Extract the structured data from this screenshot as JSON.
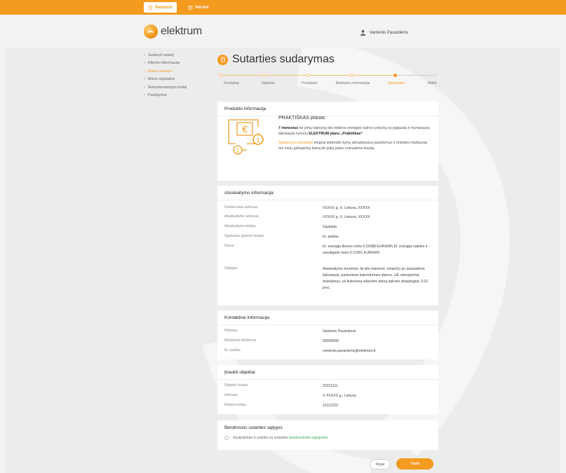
{
  "topbar": {
    "tabs": [
      {
        "label": "Namams",
        "icon": "home-icon"
      },
      {
        "label": "Verslui",
        "icon": "building-icon"
      }
    ]
  },
  "header": {
    "logo_text": "elektrum",
    "user_name": "Vardenis Pavardenis"
  },
  "sidebar": {
    "items": [
      {
        "label": "Sudaryti sutartį",
        "active": false
      },
      {
        "label": "Kliento informacija",
        "active": false
      },
      {
        "label": "Mano sutartys",
        "active": true
      },
      {
        "label": "Mano sąskaitos",
        "active": false
      },
      {
        "label": "Rekomendacijos kodai",
        "active": false
      },
      {
        "label": "Pasiūlymai",
        "active": false
      }
    ]
  },
  "page": {
    "title": "Sutarties sudarymas"
  },
  "stepper": {
    "steps": [
      {
        "label": "Kontaktai",
        "state": "done"
      },
      {
        "label": "Objektai",
        "state": "done"
      },
      {
        "label": "Produktai",
        "state": "done"
      },
      {
        "label": "Mokėjimo informacija",
        "state": "done"
      },
      {
        "label": "Santrauka",
        "state": "current"
      },
      {
        "label": "Atlikti",
        "state": "future"
      }
    ]
  },
  "product": {
    "heading": "Produkto informacija",
    "plan": "PRAKTIŠKAS planas",
    "p1_bold": "7 mėnesius",
    "p1_rest": " be jokių rūpesčių dėl elektros energijos kainos pokyčių su pigiausiu ir trumpiausiu laikotarpiu turinčiu ",
    "p1_bold2": "ELEKTRUM planu „Praktiškas“",
    "p1_end": ".",
    "p2_orange": "Savitarnos svetainėje",
    "p2_rest": " lengvai stebėsite žymų aktualiausius pasiūlymus ir rinksitės mažiausią tuo metu galiojančią kainą be jokių plano nutraukimo baudų.",
    "illus_icon": "euro-invoice-icon",
    "illus_badge": "1"
  },
  "billing": {
    "heading": "Atsiskaitymo informacija",
    "rows": [
      {
        "k": "Deklaruotas adresas",
        "v": "XXXXX g. X, Lietuva, XXXXX"
      },
      {
        "k": "Atsiskaitymo adresas",
        "v": "XXXXX g. X, Lietuva, XXXXX"
      },
      {
        "k": "Atsiskaitymo būdas",
        "v": "Sąskaita"
      },
      {
        "k": "Sąskaitos gavimo būdas",
        "v": "El. paštas"
      },
      {
        "k": "Kaina",
        "v": "El. energija dienos metu 0.15588 EUR/kWh El. energija nakties ir savaitgalio metu 0.11001 EUR/kWh"
      },
      {
        "k": "Sąlygos",
        "v": "Atsiskaitymo terminas: iki kito mėnesio, einančio po ataskaitinio laikotarpio, paskutinės kalendorinės dienos. UE vėluojančiai mokėjimas, už kiekvieną vėlavimo dieną taikomi delspinigiai: 0.02 proc."
      }
    ]
  },
  "contact": {
    "heading": "Kontaktinė informacija",
    "rows": [
      {
        "k": "Klientas",
        "v": "Vardenis Pavardenis"
      },
      {
        "k": "Mobiliusis telefonas",
        "v": "00000000"
      },
      {
        "k": "El. paštas",
        "v": "vardenis.pavardenis@elektrum.lt"
      }
    ]
  },
  "objects": {
    "heading": "Įtraukti objektai",
    "rows": [
      {
        "k": "Objekto kodas",
        "v": "22221111"
      },
      {
        "k": "Adresas",
        "v": "X XXXXX g., Lietuva"
      },
      {
        "k": "Kliento kodas",
        "v": "11112222"
      }
    ]
  },
  "terms": {
    "heading": "Bendrosios sutarties sąlygos",
    "text": "Susipažinau ir sutinku su sutarties ",
    "link": "bendrosiomis sąlygomis"
  },
  "actions": {
    "back": "Atgal",
    "next": "Tęsti"
  },
  "colors": {
    "accent": "#f39a1f",
    "link_green": "#3aa84a"
  }
}
